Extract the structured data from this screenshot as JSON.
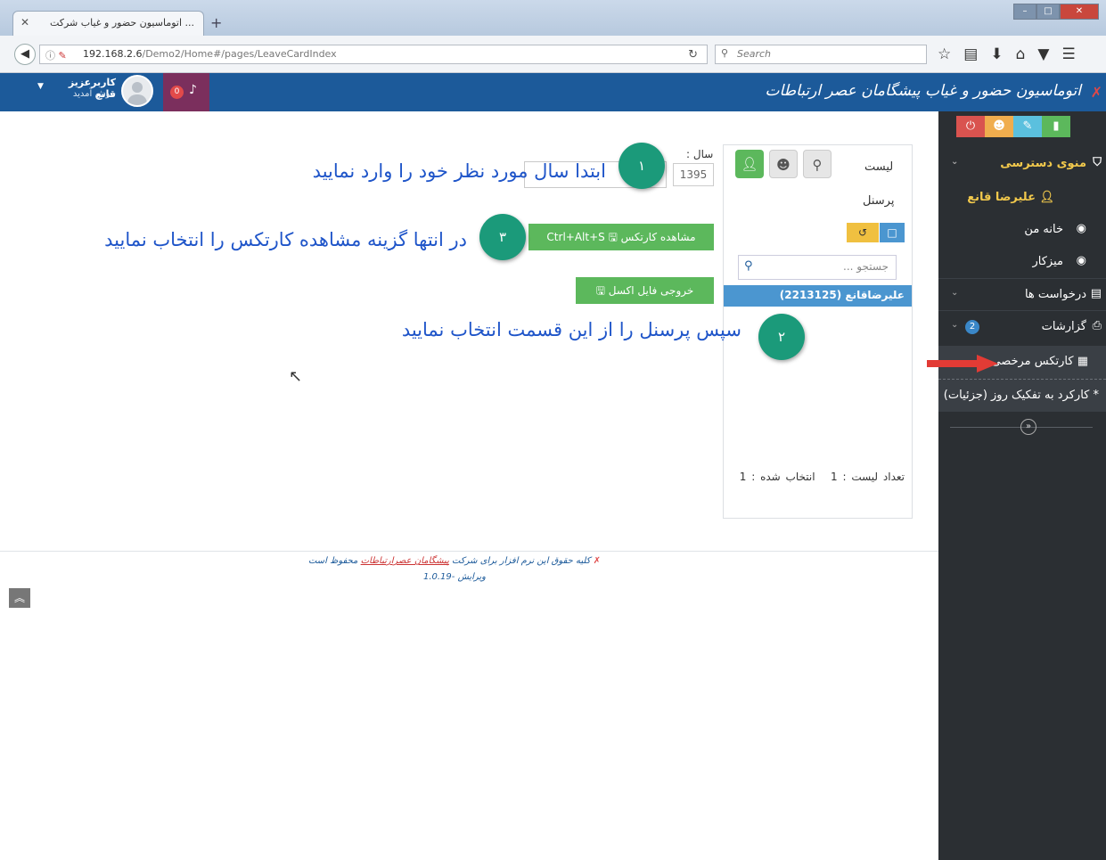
{
  "browser": {
    "tab_title": "... اتوماسیون حضور و غیاب شرکت",
    "url_host": "192.168.2.6",
    "url_path": "/Demo2/Home#/pages/LeaveCardIndex",
    "search_placeholder": "Search"
  },
  "header": {
    "app_title": "اتوماسیون حضور و غیاب پیشگامان عصر ارتباطات",
    "notif_count": "0",
    "user_name": "کاربرعزیز قانع",
    "user_welcome": "خوش آمدید"
  },
  "sidebar": {
    "access_menu": "منوی دسترسی",
    "user": "علیرضا قانع",
    "items": [
      {
        "label": "خانه من",
        "icon": "dashboard-icon"
      },
      {
        "label": "میزکار",
        "icon": "dashboard-icon"
      },
      {
        "label": "درخواست ها",
        "icon": "list-icon"
      },
      {
        "label": "گزارشات",
        "icon": "print-icon",
        "badge": "2"
      }
    ],
    "sub_items": [
      "کارتکس مرخصی",
      "کارکرد به تفکیک روز (جزئیات)"
    ]
  },
  "panel": {
    "list_label": "لیست",
    "personnel_label": "پرسنل",
    "search_placeholder": "جستجو ...",
    "selected_person": "علیرضاقانع (2213125)",
    "list_count_text": "تعداد لیست : 1",
    "selected_count_text": "انتخاب شده : 1"
  },
  "form": {
    "year_label": "سال :",
    "year_value": "1395",
    "view_cardex_button": "مشاهده کارتکس 🖫 Ctrl+Alt+S",
    "excel_button": "خروجی فایل اکسل 🖫"
  },
  "annotations": {
    "step1_number": "۱",
    "step1_text": "ابتدا سال مورد نظر خود را وارد نمایید",
    "step2_number": "۲",
    "step2_text": "سپس پرسنل را از این قسمت انتخاب نمایید",
    "step3_number": "۳",
    "step3_text": "در انتها گزینه مشاهده کارتکس را انتخاب نمایید"
  },
  "footer": {
    "copyright_pre": "کلیه حقوق این نرم افزار برای شرکت",
    "copyright_company": "پیشگامان عصرارتباطات",
    "copyright_post": "محفوظ است",
    "version": "ویرایش -1.0.19"
  },
  "colors": {
    "header_blue": "#1c5a9a",
    "sidebar_dark": "#2b2f33",
    "step_green": "#1b9a7a",
    "button_green": "#5cb85c",
    "annotation_blue": "#1f55c9"
  }
}
